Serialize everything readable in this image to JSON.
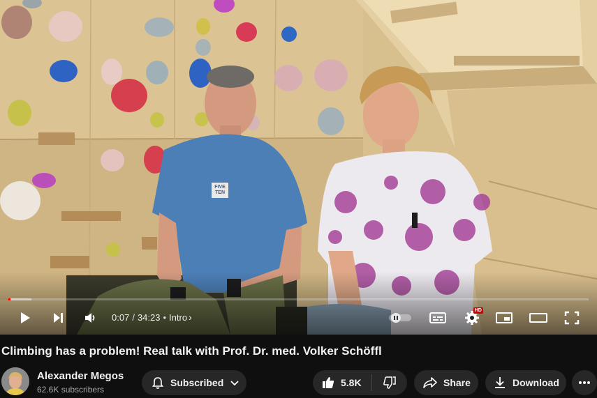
{
  "player": {
    "current_time": "0:07",
    "time_separator": "/",
    "duration": "34:23",
    "chapter_bullet": "•",
    "chapter": "Intro",
    "chapter_chevron": "›",
    "played_fraction": 0.0034,
    "loaded_fraction": 0.04,
    "settings_badge": "HD",
    "shirt_logo_line1": "FIVE",
    "shirt_logo_line2": "TEN",
    "icons": {
      "play": "play-icon",
      "next": "next-icon",
      "volume": "volume-icon",
      "autoplay": "autoplay-toggle-icon",
      "subtitles": "subtitles-icon",
      "settings": "settings-gear-icon",
      "miniplayer": "miniplayer-icon",
      "theater": "theater-mode-icon",
      "fullscreen": "fullscreen-icon"
    },
    "colors": {
      "progress_played": "#ff0000",
      "hd_badge": "#cc0000"
    }
  },
  "video": {
    "title": "Climbing has a problem! Real talk with Prof. Dr. med. Volker Schöffl"
  },
  "channel": {
    "name": "Alexander Megos",
    "subscribers": "62.6K subscribers"
  },
  "actions": {
    "subscribed_label": "Subscribed",
    "like_count": "5.8K",
    "share_label": "Share",
    "download_label": "Download"
  },
  "colors": {
    "background": "#0f0f0f",
    "pill": "#272727",
    "secondary_text": "#aaaaaa"
  }
}
